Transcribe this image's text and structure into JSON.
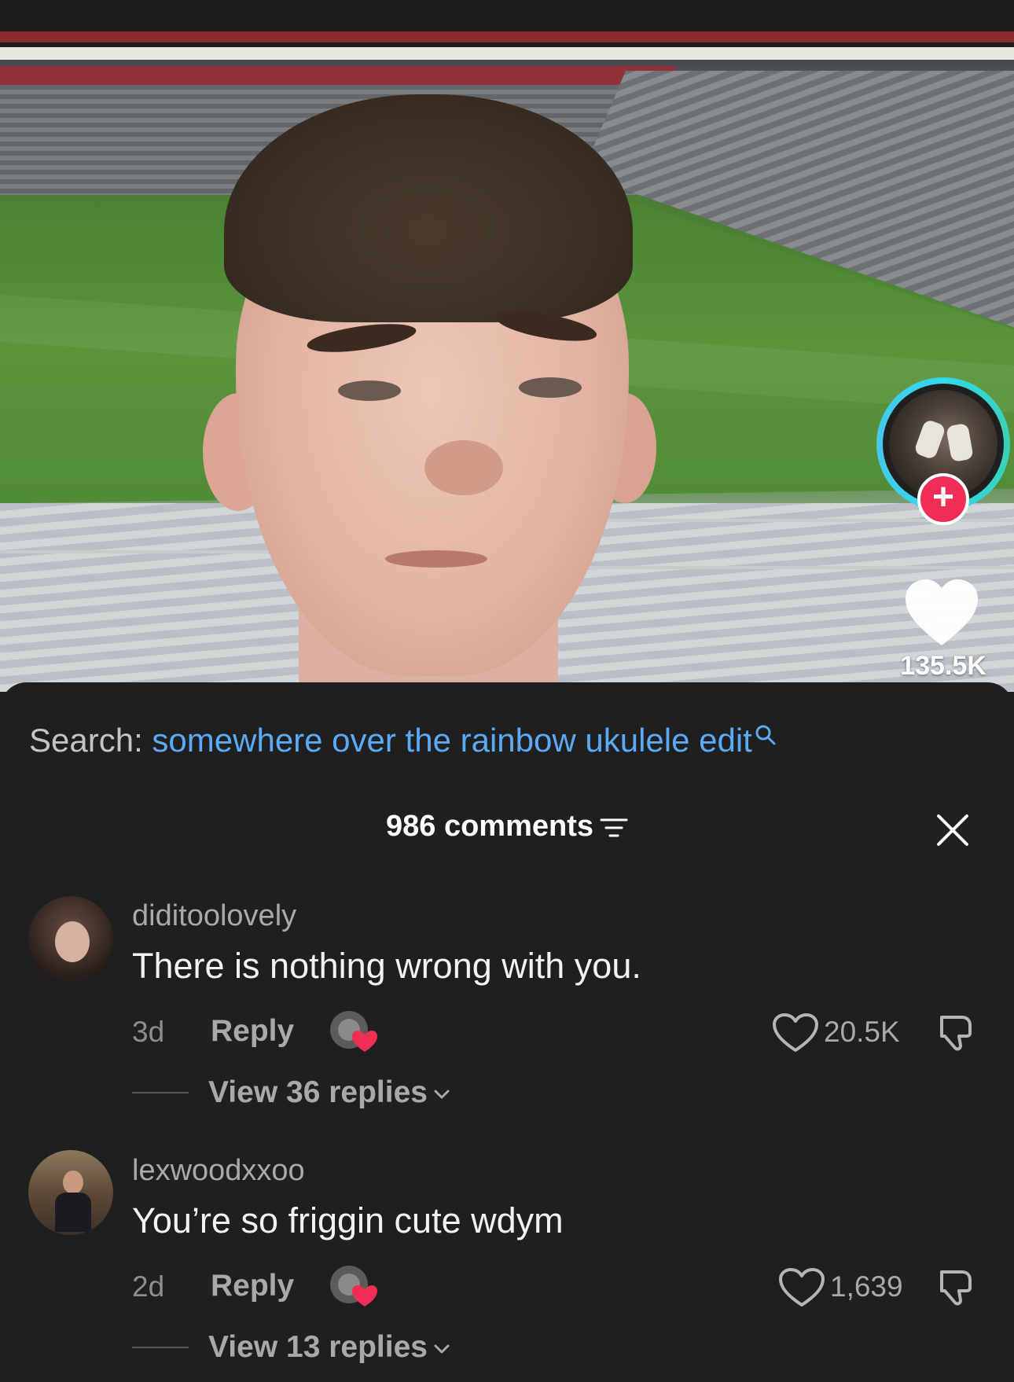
{
  "video": {
    "like_count": "135.5K",
    "icons": {
      "follow": "plus-icon",
      "like": "heart-icon"
    }
  },
  "search": {
    "prefix": "Search:",
    "query": "somewhere over the rainbow ukulele edit",
    "icon": "search-icon"
  },
  "comments_panel": {
    "title": "986 comments",
    "sort_icon": "filter-icon",
    "close_icon": "close-icon"
  },
  "comments": [
    {
      "username": "diditoolovely",
      "text": "There is nothing wrong with you.",
      "age": "3d",
      "reply_label": "Reply",
      "likes": "20.5K",
      "view_replies": "View 36 replies"
    },
    {
      "username": "lexwoodxxoo",
      "text": "You’re so friggin cute wdym",
      "age": "2d",
      "reply_label": "Reply",
      "likes": "1,639",
      "view_replies": "View 13 replies"
    }
  ],
  "colors": {
    "background": "#1f1f1f",
    "search_query": "#5aaaf5",
    "follow_red": "#ef2d55",
    "ring": "#34d8e8",
    "creator_heart": "#ef2d55"
  }
}
